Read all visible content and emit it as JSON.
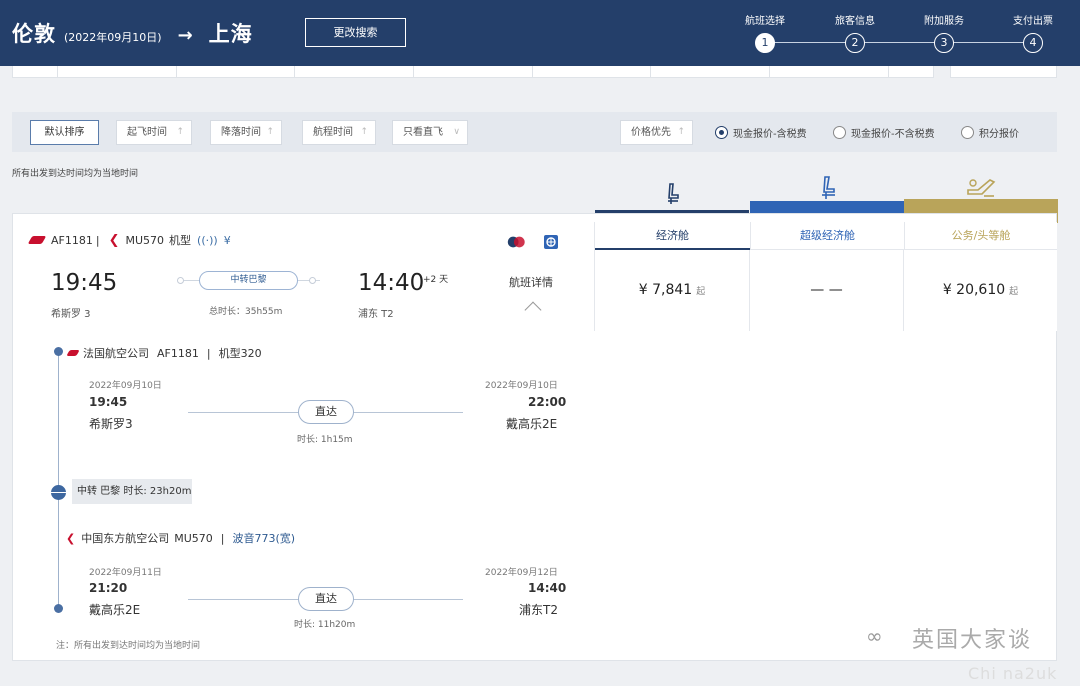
{
  "header": {
    "origin": "伦敦",
    "date": "(2022年09月10日)",
    "arrow": "→",
    "destination": "上海",
    "modify_label": "更改搜索"
  },
  "steps": [
    {
      "label": "航班选择",
      "num": "1",
      "active": true
    },
    {
      "label": "旅客信息",
      "num": "2",
      "active": false
    },
    {
      "label": "附加服务",
      "num": "3",
      "active": false
    },
    {
      "label": "支付出票",
      "num": "4",
      "active": false
    }
  ],
  "filters": {
    "default_sort": "默认排序",
    "departure_time": "起飞时间",
    "arrival_time": "降落时间",
    "duration": "航程时间",
    "direct_only": "只看直飞",
    "price_first": "价格优先",
    "radios": [
      {
        "label": "现金报价-含税费",
        "checked": true
      },
      {
        "label": "现金报价-不含税费",
        "checked": false
      },
      {
        "label": "积分报价",
        "checked": false
      }
    ],
    "local_time_note": "所有出发到达时间均为当地时间"
  },
  "flight": {
    "flight1": "AF1181",
    "divider": "|",
    "flight2": "MU570",
    "aircraft_label": "机型",
    "depart_time": "19:45",
    "depart_place": "希斯罗 3",
    "transfer": "中转巴黎",
    "total_duration": "总时长：35h55m",
    "arrive_time": "14:40",
    "plus_days": "+2 天",
    "arrive_place": "浦东 T2",
    "details_link": "航班详情"
  },
  "fares": [
    {
      "cabin": "经济舱",
      "price": "¥ 7,841",
      "suffix": "起",
      "color": "#243f6a",
      "icon": "economy-seat"
    },
    {
      "cabin": "超级经济舱",
      "price": "— —",
      "suffix": "",
      "color": "#2f64b5",
      "icon": "premium-economy-seat"
    },
    {
      "cabin": "公务/头等舱",
      "price": "¥ 20,610",
      "suffix": "起",
      "color": "#b9a45a",
      "icon": "business-seat"
    }
  ],
  "segments": [
    {
      "airline": "法国航空公司",
      "flight_no": "AF1181",
      "sep": "|",
      "aircraft": "机型320",
      "dep_date": "2022年09月10日",
      "dep_time": "19:45",
      "dep_place": "希斯罗3",
      "type": "直达",
      "duration": "时长: 1h15m",
      "arr_date": "2022年09月10日",
      "arr_time": "22:00",
      "arr_place": "戴高乐2E"
    },
    {
      "airline": "中国东方航空公司",
      "flight_no": "MU570",
      "sep": "|",
      "aircraft": "波音773(宽)",
      "dep_date": "2022年09月11日",
      "dep_time": "21:20",
      "dep_place": "戴高乐2E",
      "type": "直达",
      "duration": "时长: 11h20m",
      "arr_date": "2022年09月12日",
      "arr_time": "14:40",
      "arr_place": "浦东T2"
    }
  ],
  "layover": "中转 巴黎 时长: 23h20m",
  "footnote": "注：所有出发到达时间均为当地时间",
  "watermark": {
    "logo": "∞",
    "text": "英国大家谈",
    "url": "Chi na2uk"
  }
}
